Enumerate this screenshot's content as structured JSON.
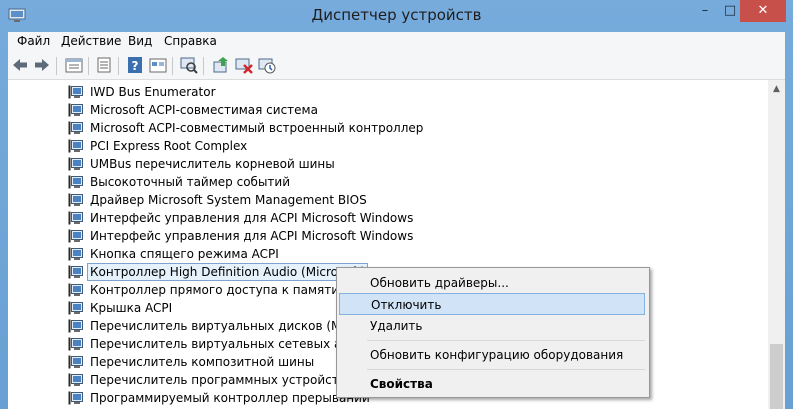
{
  "window": {
    "title": "Диспетчер устройств"
  },
  "window_controls": {
    "minimize": "–",
    "maximize": "□",
    "close": "✕"
  },
  "menu": {
    "items": [
      "Файл",
      "Действие",
      "Вид",
      "Справка"
    ]
  },
  "toolbar": {
    "icons": [
      "back-arrow-icon",
      "forward-arrow-icon",
      "device-view-icon",
      "properties-icon",
      "help-icon",
      "show-hidden-icon",
      "scan-hardware-icon",
      "update-driver-icon",
      "uninstall-icon",
      "disable-device-icon"
    ]
  },
  "devices": [
    {
      "label": "IWD Bus Enumerator"
    },
    {
      "label": "Microsoft ACPI-совместимая система"
    },
    {
      "label": "Microsoft ACPI-совместимый встроенный контроллер"
    },
    {
      "label": "PCI Express Root Complex"
    },
    {
      "label": "UMBus перечислитель корневой шины"
    },
    {
      "label": "Высокоточный таймер событий"
    },
    {
      "label": "Драйвер Microsoft System Management BIOS"
    },
    {
      "label": "Интерфейс управления для ACPI Microsoft Windows"
    },
    {
      "label": "Интерфейс управления для ACPI Microsoft Windows"
    },
    {
      "label": "Кнопка спящего режима ACPI"
    },
    {
      "label": "Контроллер High Definition Audio (Microsoft)",
      "selected": true
    },
    {
      "label": "Контроллер прямого доступа к памяти"
    },
    {
      "label": "Крышка ACPI"
    },
    {
      "label": "Перечислитель виртуальных дисков (Майкр"
    },
    {
      "label": "Перечислитель виртуальных сетевых адапте"
    },
    {
      "label": "Перечислитель композитной шины"
    },
    {
      "label": "Перечислитель программных устройств Plu"
    },
    {
      "label": "Программируемый контроллер прерывании"
    }
  ],
  "context_menu": {
    "items": [
      {
        "label": "Обновить драйверы..."
      },
      {
        "label": "Отключить",
        "highlighted": true
      },
      {
        "label": "Удалить"
      },
      {
        "label": "Обновить конфигурацию оборудования"
      },
      {
        "label": "Свойства",
        "bold": true
      }
    ]
  },
  "colors": {
    "title_bar": "#6fa4d6",
    "close_button": "#c7504a",
    "selection": "#e5f1fb",
    "menu_highlight": "#d1e3f6"
  }
}
